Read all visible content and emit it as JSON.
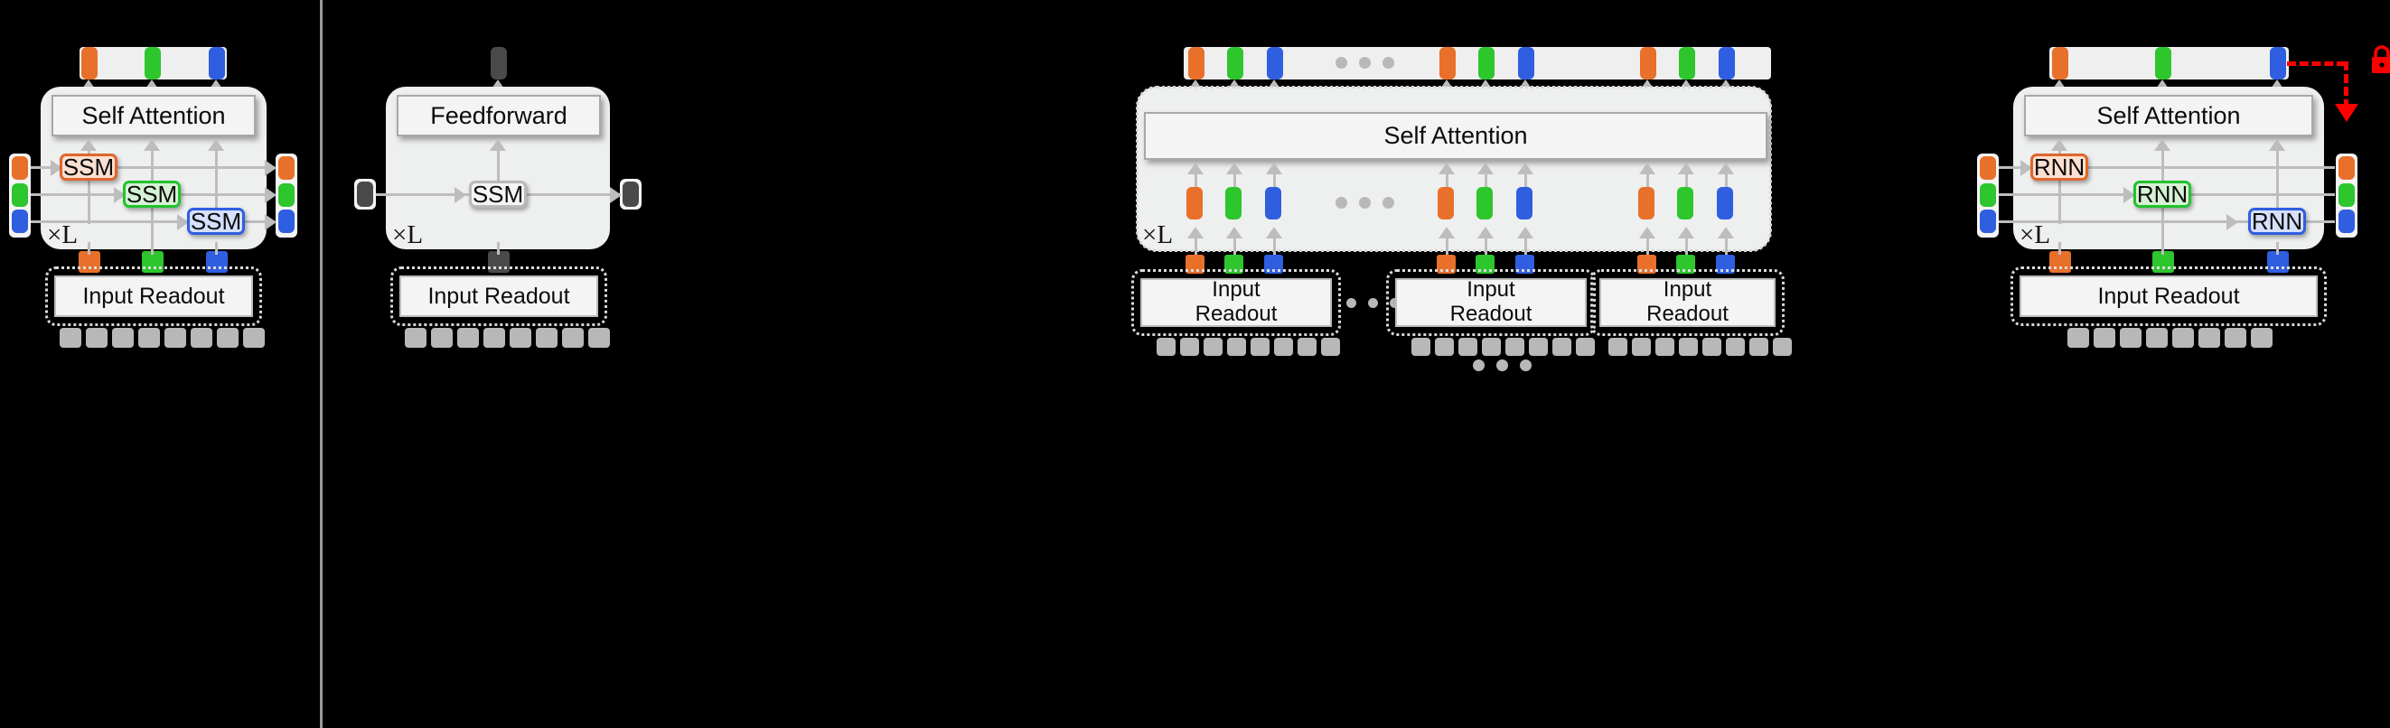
{
  "figure": {
    "background": "#000000",
    "divider_color": "#9a9a9a",
    "accent_colors": {
      "orange": "#e8702a",
      "green": "#2dc62d",
      "blue": "#2f5fe0",
      "dark": "#4a4a4a",
      "grey_chip": "#b8b8b8",
      "arrow": "#bdbdbd",
      "lock_red": "#ff0000"
    }
  },
  "panels": [
    {
      "id": "panel-1",
      "name": "ssm-self-attention-panel",
      "repeat_label": "×L",
      "attention_label": "Self Attention",
      "readout_label": "Input Readout",
      "cells": [
        "SSM",
        "SSM",
        "SSM"
      ],
      "cell_colors": [
        "orange",
        "green",
        "blue"
      ],
      "output_tokens": [
        "orange",
        "green",
        "blue"
      ],
      "input_tokens": [
        "orange",
        "green",
        "blue"
      ],
      "state_in_tokens": [
        "orange",
        "green",
        "blue"
      ],
      "state_out_tokens": [
        "orange",
        "green",
        "blue"
      ],
      "chip_count": 8
    },
    {
      "id": "panel-2",
      "name": "feedforward-ssm-panel",
      "repeat_label": "×L",
      "attention_label": "Feedforward",
      "readout_label": "Input Readout",
      "cells": [
        "SSM"
      ],
      "cell_colors": [
        "grey"
      ],
      "output_tokens": [
        "dark"
      ],
      "input_tokens": [
        "dark"
      ],
      "state_in_tokens": [
        "dark"
      ],
      "state_out_tokens": [
        "dark"
      ],
      "chip_count": 8
    },
    {
      "id": "panel-3",
      "name": "chunked-self-attention-panel",
      "repeat_label": "×L",
      "attention_label": "Self Attention",
      "readout_label_line1": "Input",
      "readout_label_line2": "Readout",
      "token_groups": 4,
      "group_tokens": [
        "orange",
        "green",
        "blue"
      ],
      "ellipsis_label": "• • •",
      "chip_count": 8,
      "readout_count": 3
    },
    {
      "id": "panel-4",
      "name": "rnn-self-attention-panel",
      "repeat_label": "×L",
      "attention_label": "Self Attention",
      "readout_label": "Input Readout",
      "cells": [
        "RNN",
        "RNN",
        "RNN"
      ],
      "cell_colors": [
        "orange",
        "green",
        "blue"
      ],
      "output_tokens": [
        "orange",
        "green",
        "blue"
      ],
      "input_tokens": [
        "orange",
        "green",
        "blue"
      ],
      "state_in_tokens": [
        "orange",
        "green",
        "blue"
      ],
      "state_out_tokens": [
        "orange",
        "green",
        "blue"
      ],
      "chip_count": 8,
      "lock_icon": "lock-closed-icon",
      "lock_color": "#ff0000"
    }
  ]
}
